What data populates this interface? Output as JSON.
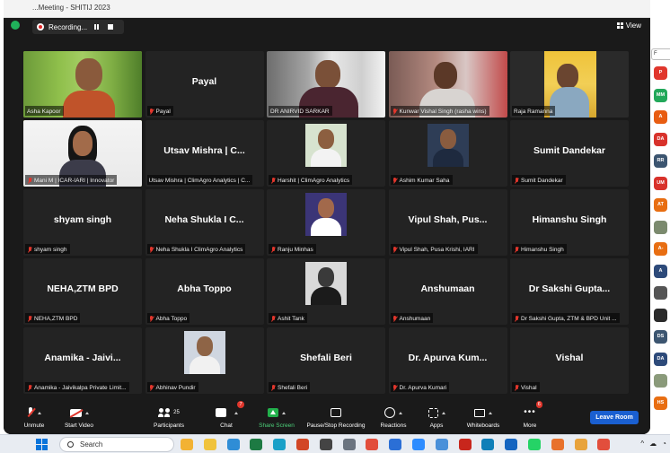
{
  "window": {
    "title": "...Meeting - SHITIJ 2023"
  },
  "recording": {
    "label": "Recording..."
  },
  "view_button": {
    "label": "View"
  },
  "tiles": [
    {
      "kind": "video",
      "label": "Asha Kapoor",
      "video": "v-asha",
      "active": true,
      "muted": false
    },
    {
      "kind": "name",
      "name": "Payal",
      "label": "Payal",
      "muted": true
    },
    {
      "kind": "video",
      "label": "DR ANIRVID SARKAR",
      "video": "v-anirvid",
      "muted": false
    },
    {
      "kind": "video",
      "label": "Kunwar Vishal Singh (rasha wins)",
      "video": "v-kunwar",
      "muted": true
    },
    {
      "kind": "video",
      "label": "Raja Ramanna",
      "video": "v-raja",
      "muted": false
    },
    {
      "kind": "video",
      "label": "Mani M | ICAR-IARI | Innovator",
      "video": "v-mani",
      "active": true,
      "muted": true
    },
    {
      "kind": "name",
      "name": "Utsav Mishra | C...",
      "label": "Utsav Mishra | ClimAgro Analytics | C...",
      "muted": false
    },
    {
      "kind": "pic",
      "label": "Harshit | ClimAgro Analytics",
      "pic": "p-harshit",
      "muted": true
    },
    {
      "kind": "pic",
      "label": "Ashim Kumar Saha",
      "pic": "p-ashim",
      "muted": true
    },
    {
      "kind": "name",
      "name": "Sumit Dandekar",
      "label": "Sumit Dandekar",
      "muted": true
    },
    {
      "kind": "name",
      "name": "shyam singh",
      "label": "shyam singh",
      "muted": true
    },
    {
      "kind": "name",
      "name": "Neha Shukla I C...",
      "label": "Neha Shukla I ClimAgro Analytics",
      "muted": true
    },
    {
      "kind": "pic",
      "label": "Ranju Minhas",
      "pic": "p-ranju",
      "muted": true
    },
    {
      "kind": "name",
      "name": "Vipul Shah, Pus...",
      "label": "Vipul Shah, Pusa Krishi, IARI",
      "muted": true
    },
    {
      "kind": "name",
      "name": "Himanshu Singh",
      "label": "Himanshu Singh",
      "muted": true
    },
    {
      "kind": "name",
      "name": "NEHA,ZTM BPD",
      "label": "NEHA,ZTM BPD",
      "muted": true
    },
    {
      "kind": "name",
      "name": "Abha Toppo",
      "label": "Abha Toppo",
      "muted": true
    },
    {
      "kind": "pic",
      "label": "Ashit Tank",
      "pic": "p-ashit",
      "muted": true
    },
    {
      "kind": "name",
      "name": "Anshumaan",
      "label": "Anshumaan",
      "muted": true
    },
    {
      "kind": "name",
      "name": "Dr Sakshi Gupta...",
      "label": "Dr Sakshi Gupta, ZTM & BPD Unit ...",
      "muted": true
    },
    {
      "kind": "name",
      "name": "Anamika - Jaivi...",
      "label": "Anamika - Jaivikalpa Private Limit...",
      "muted": true
    },
    {
      "kind": "pic",
      "label": "Abhinav Pundir",
      "pic": "p-abhinav",
      "muted": true
    },
    {
      "kind": "name",
      "name": "Shefali Beri",
      "label": "Shefali Beri",
      "muted": true
    },
    {
      "kind": "name",
      "name": "Dr. Apurva Kum...",
      "label": "Dr. Apurva Kumari",
      "muted": true
    },
    {
      "kind": "name",
      "name": "Vishal",
      "label": "Vishal",
      "muted": true
    }
  ],
  "toolbar": {
    "unmute": "Unmute",
    "start_video": "Start Video",
    "participants": "Participants",
    "participants_count": "25",
    "chat": "Chat",
    "chat_badge": "7",
    "share_screen": "Share Screen",
    "pause_stop_recording": "Pause/Stop Recording",
    "reactions": "Reactions",
    "apps": "Apps",
    "whiteboards": "Whiteboards",
    "more": "More",
    "more_badge": "6",
    "leave": "Leave Room"
  },
  "right_panel": {
    "search_placeholder": "F",
    "avatars": [
      {
        "initials": "P",
        "color": "#e0362c"
      },
      {
        "initials": "MM",
        "color": "#22a85a"
      },
      {
        "initials": "A",
        "color": "#e85d12"
      },
      {
        "initials": "DA",
        "color": "#d8322b"
      },
      {
        "initials": "RR",
        "color": "#3c5570"
      },
      {
        "initials": "UM",
        "color": "#d8322b"
      },
      {
        "initials": "AT",
        "color": "#e86e12"
      },
      {
        "initials": "",
        "color": "#7b8a6e"
      },
      {
        "initials": "A-",
        "color": "#e86e12"
      },
      {
        "initials": "A",
        "color": "#2d4a7a"
      },
      {
        "initials": "",
        "color": "#555555"
      },
      {
        "initials": "",
        "color": "#2b2b2b"
      },
      {
        "initials": "DS",
        "color": "#3c5570"
      },
      {
        "initials": "DA",
        "color": "#2d4a7a"
      },
      {
        "initials": "",
        "color": "#8a9a7a"
      },
      {
        "initials": "HS",
        "color": "#e86e12"
      }
    ]
  },
  "taskbar": {
    "search_placeholder": "Search",
    "apps": [
      {
        "name": "chrome-icon",
        "color": "#f2b233"
      },
      {
        "name": "explorer-icon",
        "color": "#f0c33c"
      },
      {
        "name": "photos-icon",
        "color": "#2f8dd6"
      },
      {
        "name": "excel-icon",
        "color": "#1d7a43"
      },
      {
        "name": "edge-icon",
        "color": "#1aa0c8"
      },
      {
        "name": "powerpoint-icon",
        "color": "#d24726"
      },
      {
        "name": "sticky-icon",
        "color": "#444444"
      },
      {
        "name": "notepad-icon",
        "color": "#6b7480"
      },
      {
        "name": "chrome2-icon",
        "color": "#e24e3c"
      },
      {
        "name": "store-icon",
        "color": "#2b6fd6"
      },
      {
        "name": "zoom-icon",
        "color": "#2d8cff"
      },
      {
        "name": "files-icon",
        "color": "#4a90d9"
      },
      {
        "name": "acrobat-icon",
        "color": "#c8261c"
      },
      {
        "name": "edge2-icon",
        "color": "#0f7fb8"
      },
      {
        "name": "outlook-icon",
        "color": "#1565c0"
      },
      {
        "name": "whatsapp-icon",
        "color": "#25d366"
      },
      {
        "name": "firefox-icon",
        "color": "#e8722c"
      },
      {
        "name": "paint-icon",
        "color": "#e8a33c"
      },
      {
        "name": "chrome3-icon",
        "color": "#e24e3c"
      }
    ]
  }
}
